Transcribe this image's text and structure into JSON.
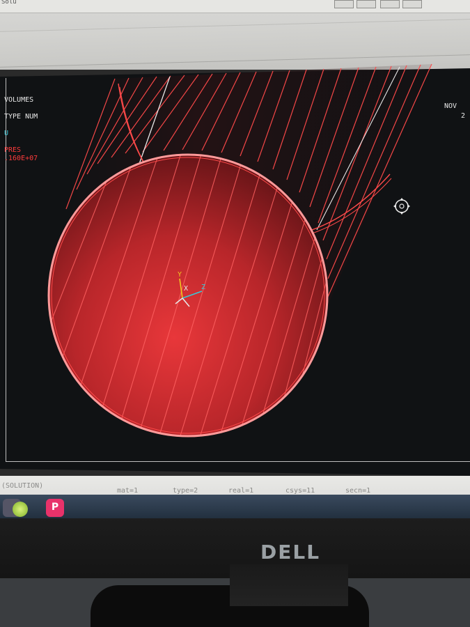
{
  "window": {
    "top_title": "Solu"
  },
  "viewport": {
    "legend": {
      "label_volumes": "VOLUMES",
      "label_type_num": "TYPE NUM",
      "label_u": "U",
      "label_pres": "PRES",
      "pres_value": ".160E+07"
    },
    "date": {
      "month": "NOV",
      "year_partial": "2"
    },
    "triad": {
      "y": "Y",
      "x": "X",
      "z": "Z"
    }
  },
  "status_bar": {
    "mode": "(SOLUTION)",
    "mat": "mat=1",
    "type": "type=2",
    "real": "real=1",
    "csys": "csys=11",
    "secn": "secn=1"
  },
  "monitor": {
    "brand": "DELL"
  },
  "colors": {
    "model_red": "#ff4a4a",
    "triad_y": "#f0c820",
    "triad_z": "#39c8d8",
    "legend_text": "#e8e8e8"
  }
}
